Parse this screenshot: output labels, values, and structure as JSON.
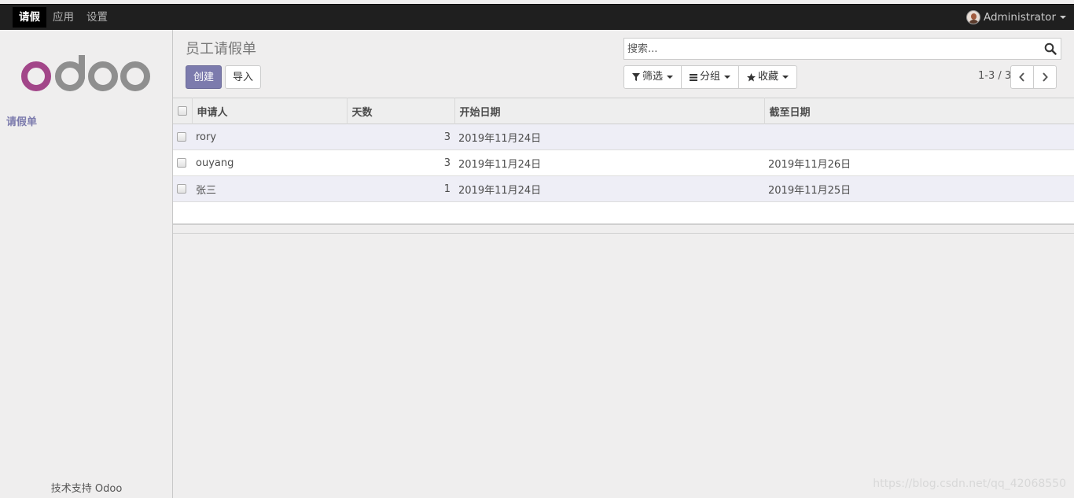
{
  "topbar": {
    "menu": [
      {
        "label": "请假",
        "active": true
      },
      {
        "label": "应用",
        "active": false
      },
      {
        "label": "设置",
        "active": false
      }
    ],
    "user": "Administrator"
  },
  "sidebar": {
    "logo_text": "odoo",
    "menu_item": "请假单",
    "powered_prefix": "技术支持",
    "powered_brand": "Odoo"
  },
  "control_panel": {
    "title": "员工请假单",
    "create_label": "创建",
    "import_label": "导入",
    "search_placeholder": "搜索...",
    "filter_label": "筛选",
    "group_label": "分组",
    "favorite_label": "收藏",
    "pager": "1-3 / 3"
  },
  "table": {
    "columns": [
      "申请人",
      "天数",
      "开始日期",
      "截至日期"
    ],
    "rows": [
      {
        "applicant": "rory",
        "days": "3",
        "start": "2019年11月24日",
        "end": ""
      },
      {
        "applicant": "ouyang",
        "days": "3",
        "start": "2019年11月24日",
        "end": "2019年11月26日"
      },
      {
        "applicant": "张三",
        "days": "1",
        "start": "2019年11月24日",
        "end": "2019年11月25日"
      }
    ]
  },
  "watermark": "https://blog.csdn.net/qq_42068550",
  "colors": {
    "primary": "#7c7bad",
    "topbar": "#1f1f1f",
    "logo_o": "#a24689",
    "logo_doo": "#8f8f8f"
  }
}
